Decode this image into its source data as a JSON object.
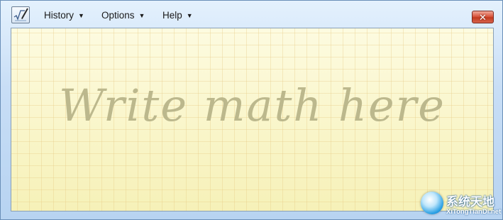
{
  "menu": {
    "history_label": "History",
    "options_label": "Options",
    "help_label": "Help"
  },
  "window": {
    "close_glyph": "✕"
  },
  "canvas": {
    "hint_text": "Write math here"
  },
  "watermark": {
    "title": "系统天地",
    "site": "XiTongTianDi.net"
  },
  "colors": {
    "canvas_bg": "#fbf8cc",
    "hint_text": "#b9b58a",
    "close_button": "#d9573f"
  },
  "icons": {
    "app": "math-input-panel-icon",
    "menu_caret": "caret-down-icon",
    "close": "close-icon"
  }
}
